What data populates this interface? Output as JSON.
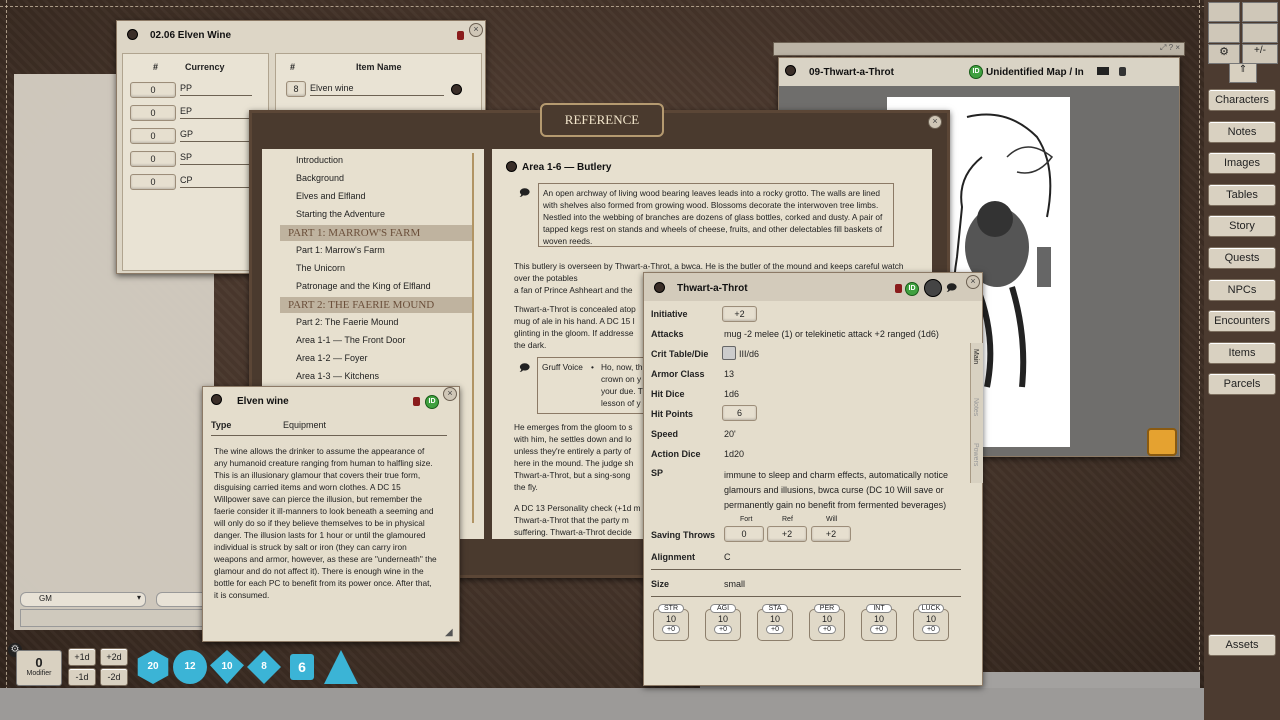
{
  "wine_window": {
    "title": "02.06 Elven Wine",
    "currency_header": {
      "num": "#",
      "label": "Currency"
    },
    "item_header": {
      "num": "#",
      "label": "Item Name"
    },
    "currencies": [
      {
        "qty": "0",
        "code": "PP"
      },
      {
        "qty": "0",
        "code": "EP"
      },
      {
        "qty": "0",
        "code": "GP"
      },
      {
        "qty": "0",
        "code": "SP"
      },
      {
        "qty": "0",
        "code": "CP"
      }
    ],
    "items": [
      {
        "qty": "8",
        "name": "Elven wine"
      }
    ]
  },
  "map_window": {
    "title": "09-Thwart-a-Throt",
    "map_name": "Unidentified Map / In",
    "id_label": "ID"
  },
  "reference": {
    "banner": "REFERENCE",
    "toc": [
      {
        "t": "item",
        "label": "Introduction"
      },
      {
        "t": "item",
        "label": "Background"
      },
      {
        "t": "item",
        "label": "Elves and Elfland"
      },
      {
        "t": "item",
        "label": "Starting the Adventure"
      },
      {
        "t": "hdr",
        "label": "PART 1: MARROW'S FARM"
      },
      {
        "t": "item",
        "label": "Part 1: Marrow's Farm"
      },
      {
        "t": "item",
        "label": "The Unicorn"
      },
      {
        "t": "item",
        "label": "Patronage and the King of Elfland"
      },
      {
        "t": "hdr",
        "label": "PART 2: THE FAERIE MOUND"
      },
      {
        "t": "item",
        "label": "Part 2: The Faerie Mound"
      },
      {
        "t": "item",
        "label": "Area 1-1 — The Front Door"
      },
      {
        "t": "item",
        "label": "Area 1-2 — Foyer"
      },
      {
        "t": "item",
        "label": "Area 1-3 — Kitchens"
      }
    ],
    "page_title": "Area 1-6 — Butlery",
    "boxed_text": "An open archway of living wood bearing leaves leads into a rocky grotto. The walls are lined with shelves also formed from growing wood. Blossoms decorate the interwoven tree limbs. Nestled into the webbing of branches are dozens of glass bottles, corked and dusty. A pair of tapped kegs rest on stands and wheels of cheese, fruits, and other delectables fill baskets of woven reeds.",
    "p1": "This butlery is overseen by Thwart-a-Throt, a bwca. He is the butler of the mound and keeps careful watch over the potables",
    "p1b": "a fan of Prince Ashheart and the",
    "p2a": "Thwart-a-Throt is concealed atop",
    "p2b": "mug of ale in his hand. A DC 15 I",
    "p2c": "glinting in the gloom. If addresse",
    "p2d": "the dark.",
    "voice_label": "Gruff Voice",
    "voice_bullet": "•",
    "voice_l1": "Ho, now, th",
    "voice_l2": "crown on y",
    "voice_l3": "your due. T",
    "voice_l4": "lesson of y",
    "p3a": "He emerges from the gloom to s",
    "p3b": "with him, he settles down and lo",
    "p3c": "unless they're entirely a party of",
    "p3d": "here in the mound. The judge sh",
    "p3e": "Thwart-a-Throt, but a sing-song",
    "p3f": "the fly.",
    "p4a": "A DC 13 Personality check (+1d m",
    "p4b": "Thwart-a-Throt that the party m",
    "p4c": "suffering. Thwart-a-Throt decide"
  },
  "item_window": {
    "title": "Elven wine",
    "type_label": "Type",
    "type_value": "Equipment",
    "description": "The wine allows the drinker to assume the appearance of any humanoid creature ranging from human to halfling size. This is an illusionary glamour that covers their true form, disguising carried items and worn clothes. A DC 15 Willpower save can pierce the illusion, but remember the faerie consider it ill-manners to look beneath a seeming and will only do so if they believe themselves to be in physical danger. The illusion lasts for 1 hour or until the glamoured individual is struck by salt or iron (they can carry iron weapons and armor, however, as these are \"underneath\" the glamour and do not affect it). There is enough wine in the bottle for each PC to benefit from its power once. After that, it is consumed."
  },
  "npc_window": {
    "title": "Thwart-a-Throt",
    "initiative_label": "Initiative",
    "initiative": "+2",
    "attacks_label": "Attacks",
    "attacks": "mug -2 melee (1) or telekinetic attack +2 ranged (1d6)",
    "crit_label": "Crit Table/Die",
    "crit": "III/d6",
    "ac_label": "Armor Class",
    "ac": "13",
    "hd_label": "Hit Dice",
    "hd": "1d6",
    "hp_label": "Hit Points",
    "hp": "6",
    "speed_label": "Speed",
    "speed": "20'",
    "ad_label": "Action Dice",
    "ad": "1d20",
    "sp_label": "SP",
    "sp": "immune to sleep and charm effects, automatically notice glamours and illusions, bwca curse (DC 10 Will save or permanently gain no benefit from fermented beverages)",
    "saves_label": "Saving Throws",
    "saves": [
      {
        "name": "Fort",
        "val": "0"
      },
      {
        "name": "Ref",
        "val": "+2"
      },
      {
        "name": "Will",
        "val": "+2"
      }
    ],
    "align_label": "Alignment",
    "align": "C",
    "size_label": "Size",
    "size": "small",
    "abilities": [
      {
        "n": "STR",
        "v": "10",
        "m": "+0"
      },
      {
        "n": "AGI",
        "v": "10",
        "m": "+0"
      },
      {
        "n": "STA",
        "v": "10",
        "m": "+0"
      },
      {
        "n": "PER",
        "v": "10",
        "m": "+0"
      },
      {
        "n": "INT",
        "v": "10",
        "m": "+0"
      },
      {
        "n": "LUCK",
        "v": "10",
        "m": "+0"
      }
    ],
    "side_tabs": [
      "Main",
      "Notes",
      "Powers"
    ]
  },
  "sidebar": {
    "buttons": [
      "Characters",
      "Notes",
      "Images",
      "Tables",
      "Story",
      "Quests",
      "NPCs",
      "Encounters",
      "Items",
      "Parcels"
    ],
    "assets": "Assets"
  },
  "chat": {
    "identity": "GM"
  },
  "modifier": {
    "value": "0",
    "label": "Modifier",
    "buttons": [
      "+1d",
      "+2d",
      "-1d",
      "-2d"
    ]
  },
  "dice": [
    "20",
    "12",
    "10",
    "8",
    "6",
    ""
  ]
}
